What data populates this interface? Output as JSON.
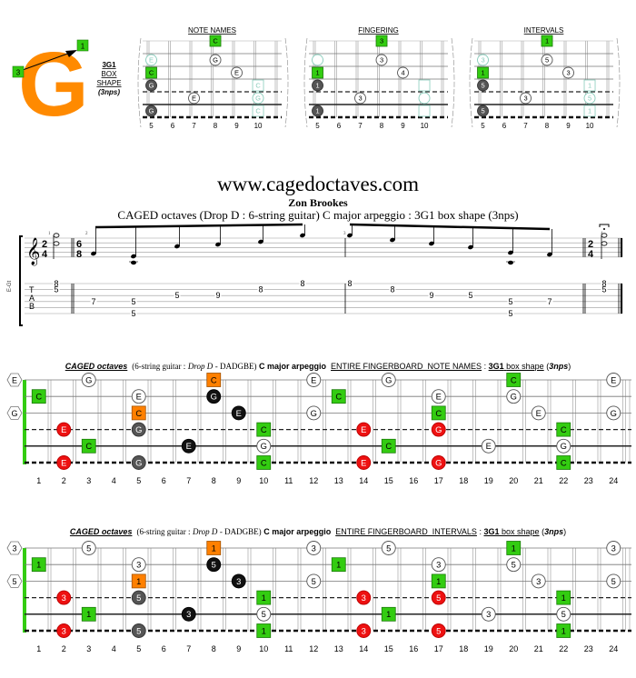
{
  "logo": {
    "letter": "G",
    "start_finger": "3",
    "end_finger": "1",
    "shape_code": "3G1",
    "shape_line2": "BOX",
    "shape_line3": "SHAPE",
    "shape_line4": "(3nps)"
  },
  "colors": {
    "green": "#33cc11",
    "orange": "#ff8000",
    "red": "#ee1111",
    "black": "#111111",
    "grey": "#555555",
    "cyan": "#88ccbb",
    "logo_orange": "#ff8a00"
  },
  "mini_diagrams": {
    "fret_labels": [
      "5",
      "6",
      "7",
      "8",
      "9",
      "10"
    ],
    "panels": [
      {
        "title": "NOTE NAMES",
        "notes": [
          {
            "string": 1,
            "fret": 8,
            "label": "C",
            "style": "green-square"
          },
          {
            "string": 2,
            "fret": 5,
            "label": "E",
            "style": "cyan-circle"
          },
          {
            "string": 2,
            "fret": 8,
            "label": "G",
            "style": "white-circle"
          },
          {
            "string": 3,
            "fret": 5,
            "label": "C",
            "style": "green-square"
          },
          {
            "string": 3,
            "fret": 9,
            "label": "E",
            "style": "white-circle"
          },
          {
            "string": 4,
            "fret": 5,
            "label": "G",
            "style": "grey-circle"
          },
          {
            "string": 4,
            "fret": 10,
            "label": "C",
            "style": "cyan-square"
          },
          {
            "string": 5,
            "fret": 7,
            "label": "E",
            "style": "white-circle"
          },
          {
            "string": 5,
            "fret": 10,
            "label": "G",
            "style": "cyan-circle"
          },
          {
            "string": 6,
            "fret": 5,
            "label": "G",
            "style": "grey-circle"
          },
          {
            "string": 6,
            "fret": 10,
            "label": "C",
            "style": "cyan-square"
          }
        ]
      },
      {
        "title": "FINGERING",
        "notes": [
          {
            "string": 1,
            "fret": 8,
            "label": "3",
            "style": "green-square"
          },
          {
            "string": 2,
            "fret": 5,
            "label": "",
            "style": "cyan-circle"
          },
          {
            "string": 2,
            "fret": 8,
            "label": "3",
            "style": "white-circle"
          },
          {
            "string": 3,
            "fret": 5,
            "label": "1",
            "style": "green-square"
          },
          {
            "string": 3,
            "fret": 9,
            "label": "4",
            "style": "white-circle"
          },
          {
            "string": 4,
            "fret": 5,
            "label": "1",
            "style": "grey-circle"
          },
          {
            "string": 4,
            "fret": 10,
            "label": "",
            "style": "cyan-square"
          },
          {
            "string": 5,
            "fret": 7,
            "label": "3",
            "style": "white-circle"
          },
          {
            "string": 5,
            "fret": 10,
            "label": "",
            "style": "cyan-circle"
          },
          {
            "string": 6,
            "fret": 5,
            "label": "1",
            "style": "grey-circle"
          },
          {
            "string": 6,
            "fret": 10,
            "label": "",
            "style": "cyan-square"
          }
        ]
      },
      {
        "title": "INTERVALS",
        "notes": [
          {
            "string": 1,
            "fret": 8,
            "label": "1",
            "style": "green-square"
          },
          {
            "string": 2,
            "fret": 5,
            "label": "3",
            "style": "cyan-circle"
          },
          {
            "string": 2,
            "fret": 8,
            "label": "5",
            "style": "white-circle"
          },
          {
            "string": 3,
            "fret": 5,
            "label": "1",
            "style": "green-square"
          },
          {
            "string": 3,
            "fret": 9,
            "label": "3",
            "style": "white-circle"
          },
          {
            "string": 4,
            "fret": 5,
            "label": "5",
            "style": "grey-circle"
          },
          {
            "string": 4,
            "fret": 10,
            "label": "1",
            "style": "cyan-square"
          },
          {
            "string": 5,
            "fret": 7,
            "label": "3",
            "style": "white-circle"
          },
          {
            "string": 5,
            "fret": 10,
            "label": "5",
            "style": "cyan-circle"
          },
          {
            "string": 6,
            "fret": 5,
            "label": "5",
            "style": "grey-circle"
          },
          {
            "string": 6,
            "fret": 10,
            "label": "1",
            "style": "cyan-square"
          }
        ]
      }
    ]
  },
  "score": {
    "site": "www.cagedoctaves.com",
    "author": "Zon Brookes",
    "subtitle": "CAGED octaves (Drop D : 6-string guitar) C major arpeggio : 3G1 box shape (3nps)",
    "instrument_label": "E-Gt",
    "tab_letters": [
      "T",
      "A",
      "B"
    ],
    "time_sig_start": [
      "2",
      "4"
    ],
    "time_sig_mid": [
      "6",
      "8"
    ],
    "time_sig_end": [
      "2",
      "4"
    ],
    "measure_numbers": [
      "1",
      "2",
      "3",
      "4"
    ],
    "tab_events": [
      {
        "measure": 1,
        "notes": [
          {
            "string": 1,
            "fret": "8"
          },
          {
            "string": 2,
            "fret": "5"
          }
        ]
      },
      {
        "measure": 2,
        "notes": [
          {
            "string": 4,
            "fret": "7"
          }
        ]
      },
      {
        "measure": 2,
        "notes": [
          {
            "string": 4,
            "fret": "5"
          },
          {
            "string": 6,
            "fret": "5"
          }
        ]
      },
      {
        "measure": 2,
        "notes": [
          {
            "string": 3,
            "fret": "5"
          }
        ]
      },
      {
        "measure": 2,
        "notes": [
          {
            "string": 3,
            "fret": "9"
          }
        ]
      },
      {
        "measure": 2,
        "notes": [
          {
            "string": 2,
            "fret": "8"
          }
        ]
      },
      {
        "measure": 2,
        "notes": [
          {
            "string": 1,
            "fret": "8"
          }
        ]
      },
      {
        "measure": 3,
        "notes": [
          {
            "string": 1,
            "fret": "8"
          }
        ]
      },
      {
        "measure": 3,
        "notes": [
          {
            "string": 2,
            "fret": "8"
          }
        ]
      },
      {
        "measure": 3,
        "notes": [
          {
            "string": 3,
            "fret": "9"
          }
        ]
      },
      {
        "measure": 3,
        "notes": [
          {
            "string": 3,
            "fret": "5"
          }
        ]
      },
      {
        "measure": 3,
        "notes": [
          {
            "string": 4,
            "fret": "5"
          },
          {
            "string": 6,
            "fret": "5"
          }
        ]
      },
      {
        "measure": 3,
        "notes": [
          {
            "string": 4,
            "fret": "7"
          }
        ]
      },
      {
        "measure": 4,
        "notes": [
          {
            "string": 1,
            "fret": "8"
          },
          {
            "string": 2,
            "fret": "5"
          }
        ]
      }
    ]
  },
  "fretboards": {
    "fret_numbers": [
      "1",
      "2",
      "3",
      "4",
      "5",
      "6",
      "7",
      "8",
      "9",
      "10",
      "11",
      "12",
      "13",
      "14",
      "15",
      "16",
      "17",
      "18",
      "19",
      "20",
      "21",
      "22",
      "23",
      "24"
    ],
    "note_names": {
      "title": {
        "caged": "CAGED octaves",
        "tuning_pre": "(6-string guitar :",
        "tuning_mode": "Drop D",
        "tuning_post": "- DADGBE)",
        "arpeggio": "C major arpeggio",
        "section": "ENTIRE FINGERBOARD  NOTE NAMES",
        "sep": ":",
        "shape": "3G1",
        "shape_text": "box shape",
        "nps_open": "(",
        "nps": "3nps",
        "nps_close": ")"
      },
      "open": [
        {
          "string": 1,
          "label": "E"
        },
        {
          "string": 3,
          "label": "G"
        }
      ],
      "notes": [
        {
          "string": 1,
          "fret": 3,
          "label": "G",
          "style": "white-circle"
        },
        {
          "string": 1,
          "fret": 8,
          "label": "C",
          "style": "orange-square"
        },
        {
          "string": 1,
          "fret": 12,
          "label": "E",
          "style": "white-circle"
        },
        {
          "string": 1,
          "fret": 15,
          "label": "G",
          "style": "white-circle"
        },
        {
          "string": 1,
          "fret": 20,
          "label": "C",
          "style": "green-square"
        },
        {
          "string": 1,
          "fret": 24,
          "label": "E",
          "style": "white-circle"
        },
        {
          "string": 2,
          "fret": 1,
          "label": "C",
          "style": "green-square"
        },
        {
          "string": 2,
          "fret": 5,
          "label": "E",
          "style": "white-circle"
        },
        {
          "string": 2,
          "fret": 8,
          "label": "G",
          "style": "black-circle"
        },
        {
          "string": 2,
          "fret": 13,
          "label": "C",
          "style": "green-square"
        },
        {
          "string": 2,
          "fret": 17,
          "label": "E",
          "style": "white-circle"
        },
        {
          "string": 2,
          "fret": 20,
          "label": "G",
          "style": "white-circle"
        },
        {
          "string": 3,
          "fret": 5,
          "label": "C",
          "style": "orange-square"
        },
        {
          "string": 3,
          "fret": 9,
          "label": "E",
          "style": "black-circle"
        },
        {
          "string": 3,
          "fret": 12,
          "label": "G",
          "style": "white-circle"
        },
        {
          "string": 3,
          "fret": 17,
          "label": "C",
          "style": "green-square"
        },
        {
          "string": 3,
          "fret": 21,
          "label": "E",
          "style": "white-circle"
        },
        {
          "string": 3,
          "fret": 24,
          "label": "G",
          "style": "white-circle"
        },
        {
          "string": 4,
          "fret": 2,
          "label": "E",
          "style": "red-circle"
        },
        {
          "string": 4,
          "fret": 5,
          "label": "G",
          "style": "grey-circle"
        },
        {
          "string": 4,
          "fret": 10,
          "label": "C",
          "style": "green-square"
        },
        {
          "string": 4,
          "fret": 14,
          "label": "E",
          "style": "red-circle"
        },
        {
          "string": 4,
          "fret": 17,
          "label": "G",
          "style": "red-circle"
        },
        {
          "string": 4,
          "fret": 22,
          "label": "C",
          "style": "green-square"
        },
        {
          "string": 5,
          "fret": 3,
          "label": "C",
          "style": "green-square"
        },
        {
          "string": 5,
          "fret": 7,
          "label": "E",
          "style": "black-circle"
        },
        {
          "string": 5,
          "fret": 10,
          "label": "G",
          "style": "white-circle"
        },
        {
          "string": 5,
          "fret": 15,
          "label": "C",
          "style": "green-square"
        },
        {
          "string": 5,
          "fret": 19,
          "label": "E",
          "style": "white-circle"
        },
        {
          "string": 5,
          "fret": 22,
          "label": "G",
          "style": "white-circle"
        },
        {
          "string": 6,
          "fret": 2,
          "label": "E",
          "style": "red-circle"
        },
        {
          "string": 6,
          "fret": 5,
          "label": "G",
          "style": "grey-circle"
        },
        {
          "string": 6,
          "fret": 10,
          "label": "C",
          "style": "green-square"
        },
        {
          "string": 6,
          "fret": 14,
          "label": "E",
          "style": "red-circle"
        },
        {
          "string": 6,
          "fret": 17,
          "label": "G",
          "style": "red-circle"
        },
        {
          "string": 6,
          "fret": 22,
          "label": "C",
          "style": "green-square"
        }
      ]
    },
    "intervals": {
      "title": {
        "caged": "CAGED octaves",
        "tuning_pre": "(6-string guitar :",
        "tuning_mode": "Drop D",
        "tuning_post": "- DADGBE)",
        "arpeggio": "C major arpeggio",
        "section": "ENTIRE FINGERBOARD  INTERVALS",
        "sep": ":",
        "shape": "3G1",
        "shape_text": "box shape",
        "nps_open": "(",
        "nps": "3nps",
        "nps_close": ")"
      },
      "open": [
        {
          "string": 1,
          "label": "3"
        },
        {
          "string": 3,
          "label": "5"
        }
      ],
      "notes": [
        {
          "string": 1,
          "fret": 3,
          "label": "5",
          "style": "white-circle"
        },
        {
          "string": 1,
          "fret": 8,
          "label": "1",
          "style": "orange-square"
        },
        {
          "string": 1,
          "fret": 12,
          "label": "3",
          "style": "white-circle"
        },
        {
          "string": 1,
          "fret": 15,
          "label": "5",
          "style": "white-circle"
        },
        {
          "string": 1,
          "fret": 20,
          "label": "1",
          "style": "green-square"
        },
        {
          "string": 1,
          "fret": 24,
          "label": "3",
          "style": "white-circle"
        },
        {
          "string": 2,
          "fret": 1,
          "label": "1",
          "style": "green-square"
        },
        {
          "string": 2,
          "fret": 5,
          "label": "3",
          "style": "white-circle"
        },
        {
          "string": 2,
          "fret": 8,
          "label": "5",
          "style": "black-circle"
        },
        {
          "string": 2,
          "fret": 13,
          "label": "1",
          "style": "green-square"
        },
        {
          "string": 2,
          "fret": 17,
          "label": "3",
          "style": "white-circle"
        },
        {
          "string": 2,
          "fret": 20,
          "label": "5",
          "style": "white-circle"
        },
        {
          "string": 3,
          "fret": 5,
          "label": "1",
          "style": "orange-square"
        },
        {
          "string": 3,
          "fret": 9,
          "label": "3",
          "style": "black-circle"
        },
        {
          "string": 3,
          "fret": 12,
          "label": "5",
          "style": "white-circle"
        },
        {
          "string": 3,
          "fret": 17,
          "label": "1",
          "style": "green-square"
        },
        {
          "string": 3,
          "fret": 21,
          "label": "3",
          "style": "white-circle"
        },
        {
          "string": 3,
          "fret": 24,
          "label": "5",
          "style": "white-circle"
        },
        {
          "string": 4,
          "fret": 2,
          "label": "3",
          "style": "red-circle"
        },
        {
          "string": 4,
          "fret": 5,
          "label": "5",
          "style": "grey-circle"
        },
        {
          "string": 4,
          "fret": 10,
          "label": "1",
          "style": "green-square"
        },
        {
          "string": 4,
          "fret": 14,
          "label": "3",
          "style": "red-circle"
        },
        {
          "string": 4,
          "fret": 17,
          "label": "5",
          "style": "red-circle"
        },
        {
          "string": 4,
          "fret": 22,
          "label": "1",
          "style": "green-square"
        },
        {
          "string": 5,
          "fret": 3,
          "label": "1",
          "style": "green-square"
        },
        {
          "string": 5,
          "fret": 7,
          "label": "3",
          "style": "black-circle"
        },
        {
          "string": 5,
          "fret": 10,
          "label": "5",
          "style": "white-circle"
        },
        {
          "string": 5,
          "fret": 15,
          "label": "1",
          "style": "green-square"
        },
        {
          "string": 5,
          "fret": 19,
          "label": "3",
          "style": "white-circle"
        },
        {
          "string": 5,
          "fret": 22,
          "label": "5",
          "style": "white-circle"
        },
        {
          "string": 6,
          "fret": 2,
          "label": "3",
          "style": "red-circle"
        },
        {
          "string": 6,
          "fret": 5,
          "label": "5",
          "style": "grey-circle"
        },
        {
          "string": 6,
          "fret": 10,
          "label": "1",
          "style": "green-square"
        },
        {
          "string": 6,
          "fret": 14,
          "label": "3",
          "style": "red-circle"
        },
        {
          "string": 6,
          "fret": 17,
          "label": "5",
          "style": "red-circle"
        },
        {
          "string": 6,
          "fret": 22,
          "label": "1",
          "style": "green-square"
        }
      ]
    }
  }
}
